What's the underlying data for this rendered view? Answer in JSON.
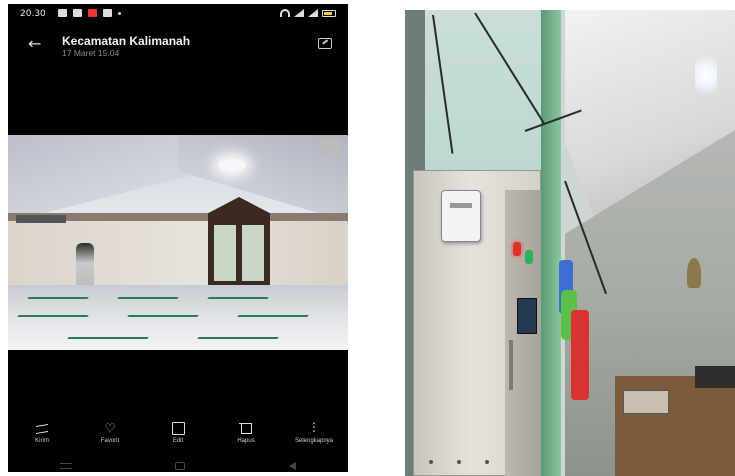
{
  "status_bar": {
    "time": "20.30"
  },
  "header": {
    "title": "Kecamatan Kalimanah",
    "subtitle": "17 Maret 15.04"
  },
  "icons": {
    "back": "arrow-left-icon",
    "edit_top": "image-edit-icon"
  },
  "actions": [
    {
      "label": "Kirim",
      "icon": "share-icon"
    },
    {
      "label": "Favorit",
      "icon": "heart-icon"
    },
    {
      "label": "Edit",
      "icon": "edit-icon"
    },
    {
      "label": "Hapus",
      "icon": "trash-icon"
    },
    {
      "label": "Selengkapnya",
      "icon": "more-icon"
    }
  ],
  "colors": {
    "phone_bg": "#000000",
    "text_primary": "#f2f2f2",
    "text_secondary": "#8a8a8a",
    "youtube_red": "#e33333",
    "battery_yellow": "#f3d21b"
  }
}
